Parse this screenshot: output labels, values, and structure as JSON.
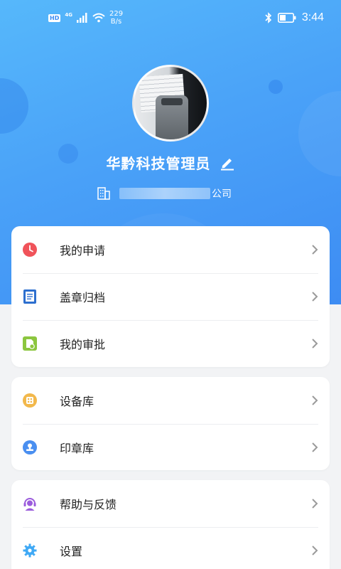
{
  "status_bar": {
    "hd": "HD",
    "network": "4G",
    "speed_value": "229",
    "speed_unit": "B/s",
    "time": "3:44",
    "icons": [
      "signal-icon",
      "wifi-icon",
      "bluetooth-icon",
      "battery-icon"
    ]
  },
  "profile": {
    "username": "华黔科技管理员",
    "company_suffix": "公司"
  },
  "menu_groups": [
    {
      "items": [
        {
          "label": "我的申请",
          "icon": "clock-icon",
          "color": "#f0535a"
        },
        {
          "label": "盖章归档",
          "icon": "document-icon",
          "color": "#2d6fcf"
        },
        {
          "label": "我的审批",
          "icon": "approval-icon",
          "color": "#8cc63f"
        }
      ]
    },
    {
      "items": [
        {
          "label": "设备库",
          "icon": "device-library-icon",
          "color": "#f2b84b"
        },
        {
          "label": "印章库",
          "icon": "seal-icon",
          "color": "#4a8ff0"
        }
      ]
    },
    {
      "items": [
        {
          "label": "帮助与反馈",
          "icon": "support-icon",
          "color": "#9b5cdc"
        },
        {
          "label": "设置",
          "icon": "gear-icon",
          "color": "#3fa9f5"
        }
      ]
    }
  ],
  "colors": {
    "hero_start": "#56b8fb",
    "hero_end": "#3d8cf3",
    "page_background": "#f2f3f5",
    "chevron": "#9a9a9a"
  }
}
